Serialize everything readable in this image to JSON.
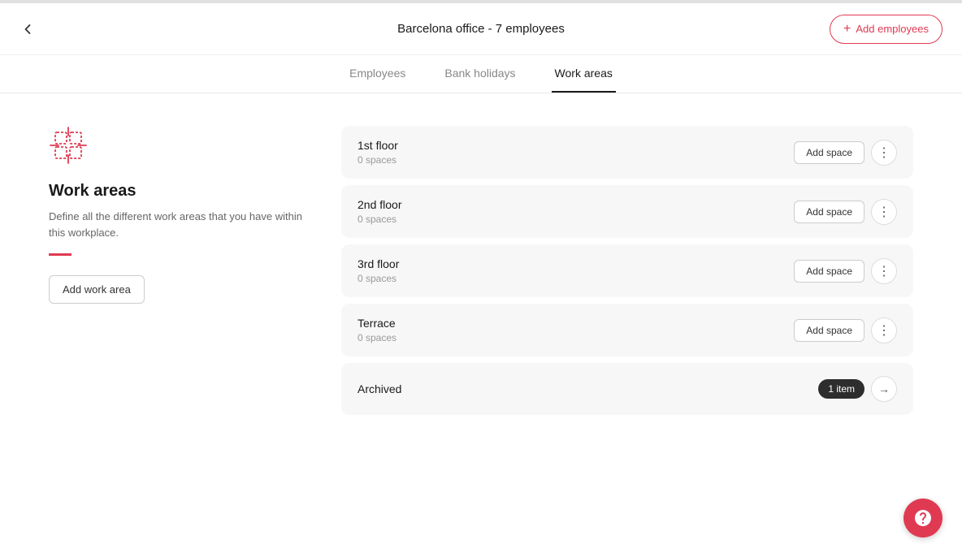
{
  "progress": {
    "fill_width": "96%"
  },
  "header": {
    "title": "Barcelona office - 7 employees",
    "add_employees_label": "Add employees"
  },
  "tabs": [
    {
      "id": "employees",
      "label": "Employees",
      "active": false
    },
    {
      "id": "bank-holidays",
      "label": "Bank holidays",
      "active": false
    },
    {
      "id": "work-areas",
      "label": "Work areas",
      "active": true
    }
  ],
  "left_panel": {
    "icon_label": "work-areas-icon",
    "title": "Work areas",
    "description": "Define all the different work areas that you have within this workplace.",
    "add_work_area_label": "Add work area"
  },
  "work_areas": [
    {
      "id": "1st-floor",
      "name": "1st floor",
      "spaces": "0 spaces",
      "add_space_label": "Add space"
    },
    {
      "id": "2nd-floor",
      "name": "2nd floor",
      "spaces": "0 spaces",
      "add_space_label": "Add space"
    },
    {
      "id": "3rd-floor",
      "name": "3rd floor",
      "spaces": "0 spaces",
      "add_space_label": "Add space"
    },
    {
      "id": "terrace",
      "name": "Terrace",
      "spaces": "0 spaces",
      "add_space_label": "Add space"
    }
  ],
  "archived": {
    "label": "Archived",
    "badge": "1 item"
  }
}
